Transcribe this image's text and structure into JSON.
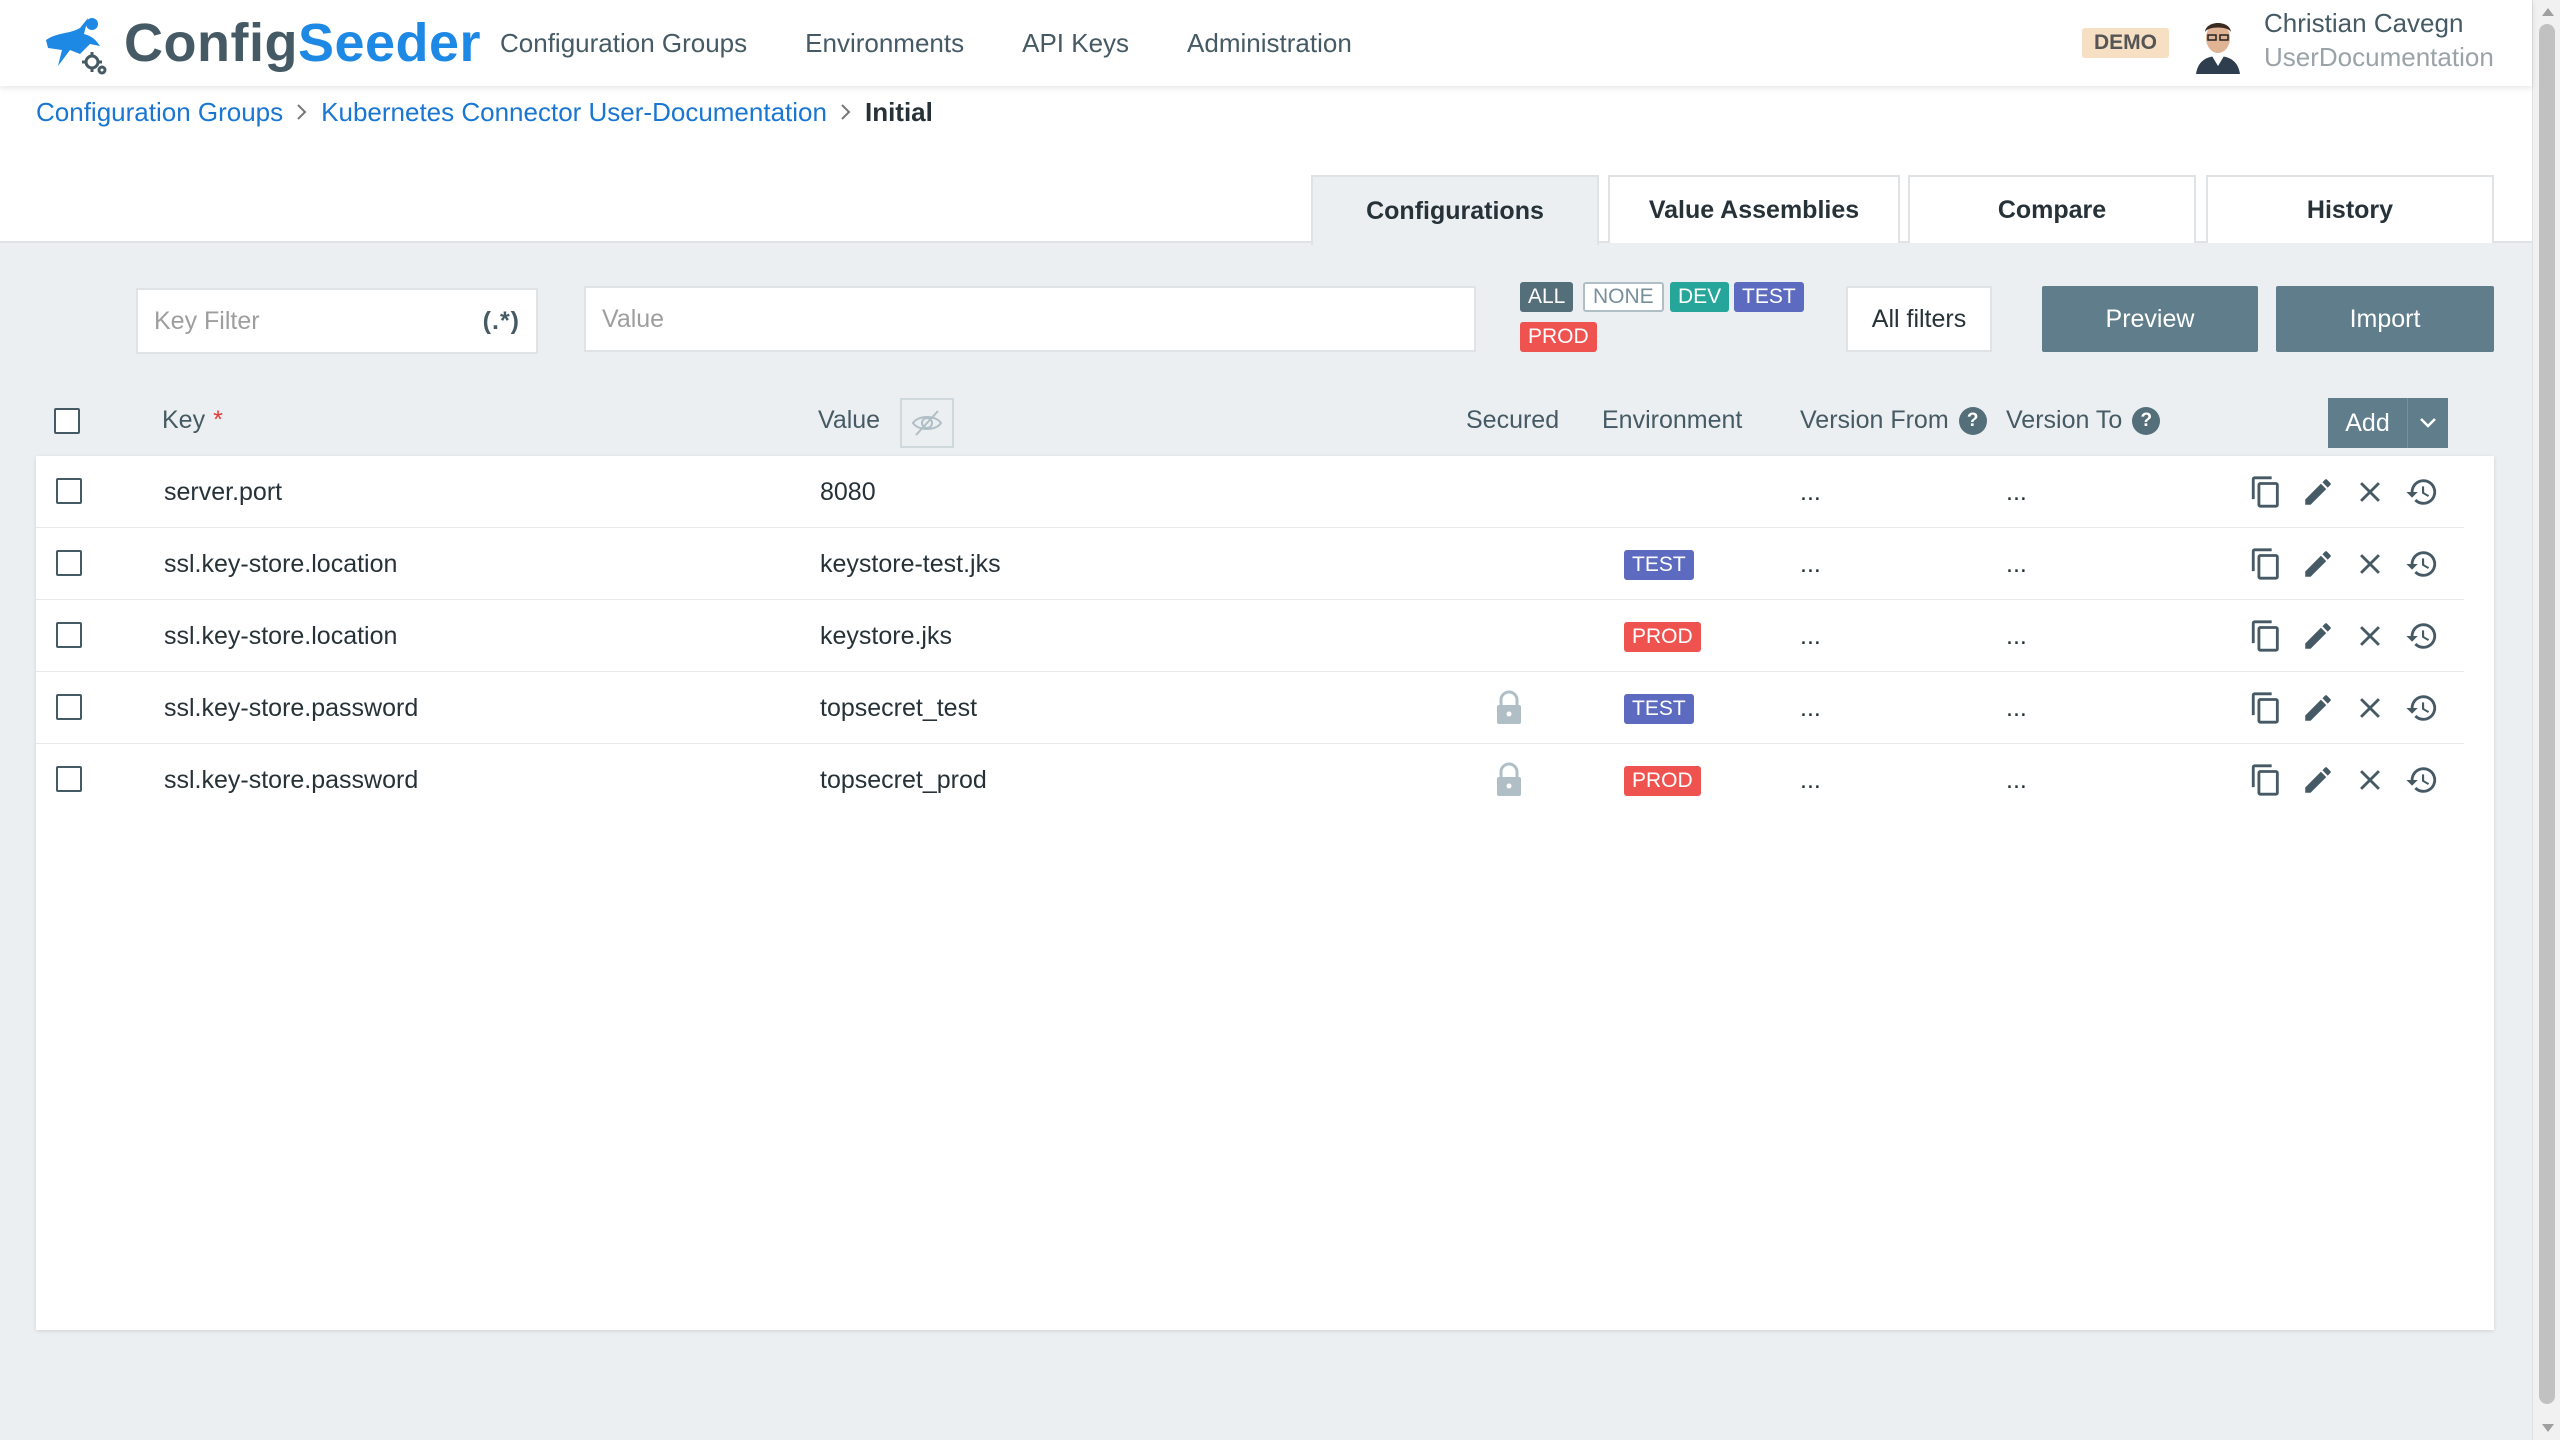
{
  "header": {
    "logo_part1": "Config",
    "logo_part2": "Seeder",
    "nav": [
      "Configuration Groups",
      "Environments",
      "API Keys",
      "Administration"
    ],
    "badge": "DEMO",
    "user_name": "Christian Cavegn",
    "user_context": "UserDocumentation"
  },
  "breadcrumb": {
    "items": [
      "Configuration Groups",
      "Kubernetes Connector User-Documentation"
    ],
    "current": "Initial"
  },
  "tabs": [
    "Configurations",
    "Value Assemblies",
    "Compare",
    "History"
  ],
  "active_tab": "Configurations",
  "filters": {
    "key_placeholder": "Key Filter",
    "regex_label": "(.*)",
    "value_placeholder": "Value",
    "env_chips": [
      "ALL",
      "NONE",
      "DEV",
      "TEST",
      "PROD"
    ],
    "all_filters": "All filters",
    "preview": "Preview",
    "import": "Import"
  },
  "colors": {
    "dev": "#26a69a",
    "test": "#5c6bc0",
    "prod": "#ef5350",
    "primary_link": "#1976d2",
    "button": "#607d8b"
  },
  "table": {
    "headers": {
      "key": "Key",
      "required": "*",
      "value": "Value",
      "secured": "Secured",
      "environment": "Environment",
      "version_from": "Version From",
      "version_to": "Version To",
      "help": "?"
    },
    "add_label": "Add",
    "rows": [
      {
        "key": "server.port",
        "value": "8080",
        "secured": false,
        "environment": "",
        "version_from": "...",
        "version_to": "..."
      },
      {
        "key": "ssl.key-store.location",
        "value": "keystore-test.jks",
        "secured": false,
        "environment": "TEST",
        "version_from": "...",
        "version_to": "..."
      },
      {
        "key": "ssl.key-store.location",
        "value": "keystore.jks",
        "secured": false,
        "environment": "PROD",
        "version_from": "...",
        "version_to": "..."
      },
      {
        "key": "ssl.key-store.password",
        "value": "topsecret_test",
        "secured": true,
        "environment": "TEST",
        "version_from": "...",
        "version_to": "..."
      },
      {
        "key": "ssl.key-store.password",
        "value": "topsecret_prod",
        "secured": true,
        "environment": "PROD",
        "version_from": "...",
        "version_to": "..."
      }
    ],
    "row_actions": [
      "copy-icon",
      "edit-icon",
      "delete-icon",
      "history-icon"
    ]
  }
}
